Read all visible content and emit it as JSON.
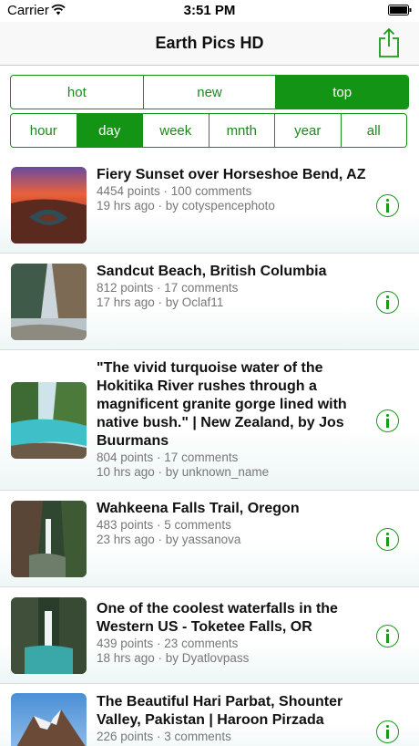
{
  "status_bar": {
    "carrier": "Carrier",
    "time": "3:51 PM"
  },
  "nav": {
    "title": "Earth Pics HD"
  },
  "sort_tabs": [
    "hot",
    "new",
    "top"
  ],
  "sort_active": "top",
  "time_tabs": [
    "hour",
    "day",
    "week",
    "mnth",
    "year",
    "all"
  ],
  "time_active": "day",
  "posts": [
    {
      "title": "Fiery Sunset over Horseshoe Bend, AZ",
      "stats": "4454 points · 100 comments",
      "byline": "19 hrs ago · by cotyspencephoto"
    },
    {
      "title": "Sandcut Beach, British Columbia",
      "stats": "812 points · 17 comments",
      "byline": "17 hrs ago · by Oclaf11"
    },
    {
      "title": "\"The vivid turquoise water of the Hokitika River rushes through a magnificent granite gorge lined with native bush.\" | New Zealand, by Jos Buurmans",
      "stats": "804 points · 17 comments",
      "byline": "10 hrs ago · by unknown_name"
    },
    {
      "title": "Wahkeena Falls Trail, Oregon",
      "stats": "483 points · 5 comments",
      "byline": "23 hrs ago · by yassanova"
    },
    {
      "title": "One of the coolest waterfalls in the Western US - Toketee Falls, OR",
      "stats": "439 points · 23 comments",
      "byline": "18 hrs ago · by Dyatlovpass"
    },
    {
      "title": "The Beautiful Hari Parbat, Shounter Valley, Pakistan | Haroon Pirzada",
      "stats": "226 points · 3 comments",
      "byline": ""
    }
  ],
  "colors": {
    "accent": "#149414",
    "meta_text": "#777777"
  },
  "icons": {
    "share": "share-icon",
    "info": "info-icon",
    "wifi": "wifi-icon",
    "battery": "battery-icon"
  }
}
